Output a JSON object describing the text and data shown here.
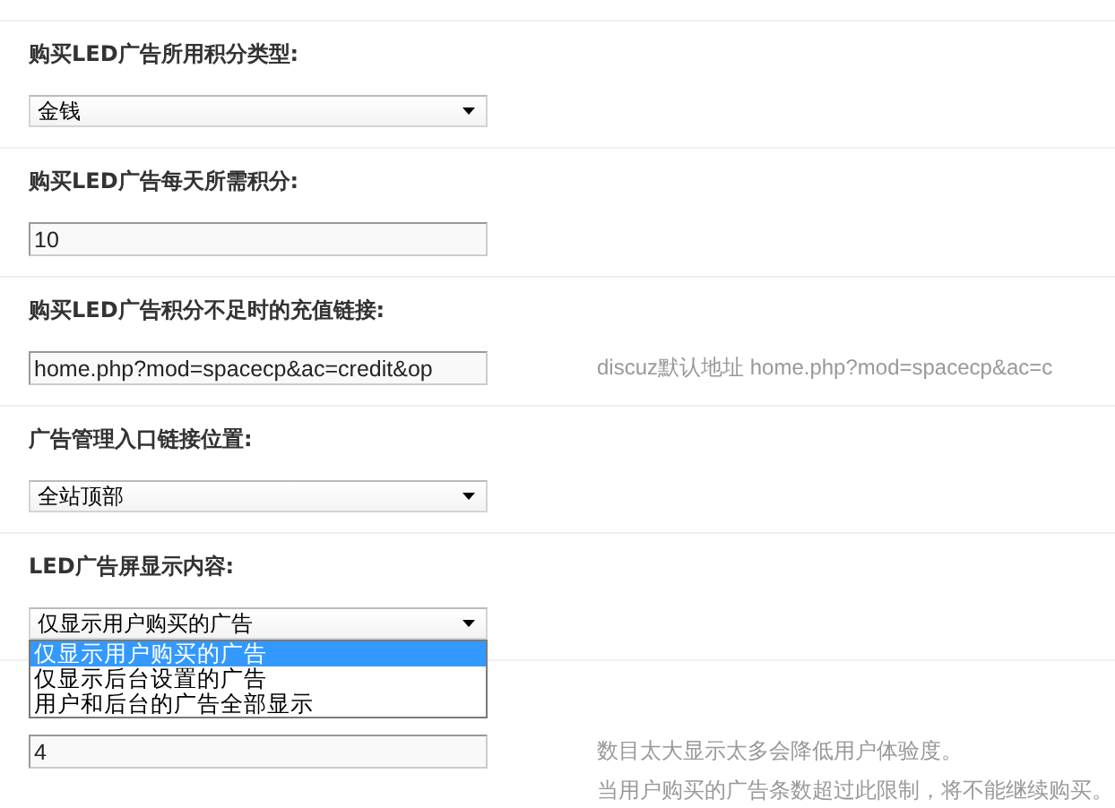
{
  "settings": [
    {
      "kind": "select",
      "label": "购买LED广告所用积分类型:",
      "value": "金钱",
      "open": false
    },
    {
      "kind": "input",
      "label": "购买LED广告每天所需积分:",
      "value": "10"
    },
    {
      "kind": "input",
      "label": "购买LED广告积分不足时的充值链接:",
      "value": "home.php?mod=spacecp&ac=credit&op",
      "hints": [
        "discuz默认地址  home.php?mod=spacecp&ac=c"
      ]
    },
    {
      "kind": "select",
      "label": "广告管理入口链接位置:",
      "value": "全站顶部",
      "open": false
    },
    {
      "kind": "select",
      "label": "LED广告屏显示内容:",
      "value": "仅显示用户购买的广告",
      "open": true,
      "options": [
        {
          "label": "仅显示用户购买的广告",
          "selected": true
        },
        {
          "label": "仅显示后台设置的广告",
          "selected": false
        },
        {
          "label": "用户和后台的广告全部显示",
          "selected": false
        }
      ]
    },
    {
      "kind": "input",
      "value": "4",
      "hints": [
        "数目太大显示太多会降低用户体验度。",
        "当用户购买的广告条数超过此限制，将不能继续购买。"
      ]
    }
  ]
}
